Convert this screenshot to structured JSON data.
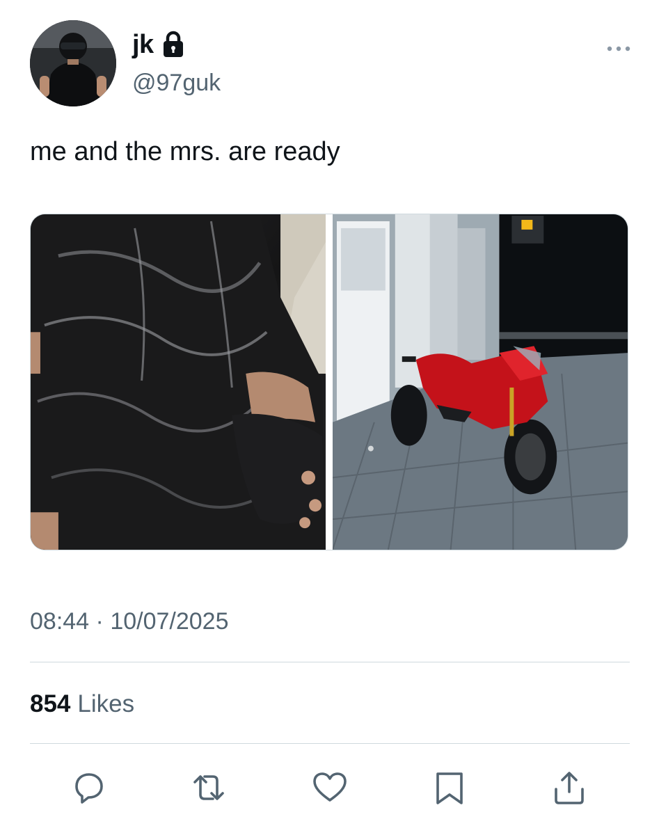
{
  "author": {
    "display_name": "jk",
    "handle": "@97guk",
    "protected": true,
    "avatar_icon": "avatar-photo"
  },
  "tweet": {
    "text": "me and the mrs. are ready",
    "time": "08:44",
    "separator": "·",
    "date": "10/07/2025"
  },
  "media": [
    {
      "description_icon": "leather-jacket-photo"
    },
    {
      "description_icon": "red-motorcycle-photo"
    }
  ],
  "stats": {
    "likes_count": "854",
    "likes_label": "Likes"
  },
  "actions": [
    {
      "icon": "reply-icon"
    },
    {
      "icon": "retweet-icon"
    },
    {
      "icon": "like-icon"
    },
    {
      "icon": "bookmark-icon"
    },
    {
      "icon": "share-icon"
    }
  ],
  "colors": {
    "text_primary": "#0f1419",
    "text_secondary": "#536471",
    "divider": "#cfd9de",
    "icon": "#536471"
  }
}
